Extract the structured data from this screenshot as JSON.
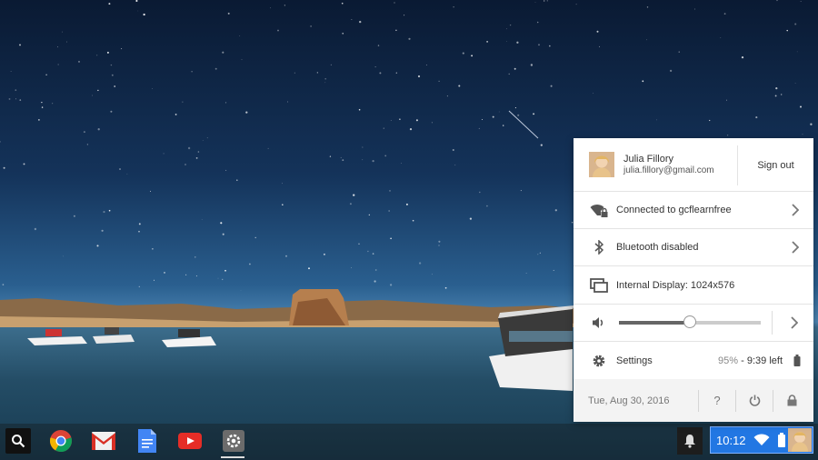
{
  "tray": {
    "user": {
      "name": "Julia Fillory",
      "email": "julia.fillory@gmail.com",
      "sign_out_label": "Sign out"
    },
    "network": {
      "label": "Connected to gcflearnfree",
      "icon": "wifi-locked-icon"
    },
    "bluetooth": {
      "label": "Bluetooth disabled",
      "icon": "bluetooth-icon"
    },
    "display": {
      "label": "Internal Display: 1024x576",
      "icon": "display-icon"
    },
    "volume": {
      "level": 0.5,
      "icon": "volume-icon"
    },
    "settings": {
      "label": "Settings",
      "battery_percent": "95%",
      "battery_sep": " - ",
      "battery_time": "9:39 left"
    },
    "footer": {
      "date": "Tue, Aug 30, 2016",
      "help": "?",
      "icons": [
        "help-icon",
        "power-icon",
        "lock-icon"
      ]
    }
  },
  "shelf": {
    "apps": [
      "search-launcher-icon",
      "chrome-icon",
      "gmail-icon",
      "docs-icon",
      "youtube-icon",
      "settings-app-icon"
    ],
    "status": {
      "time": "10:12"
    }
  },
  "colors": {
    "accent": "#2277e3",
    "tray_bg": "#ffffff",
    "footer_bg": "#f3f3f3"
  }
}
